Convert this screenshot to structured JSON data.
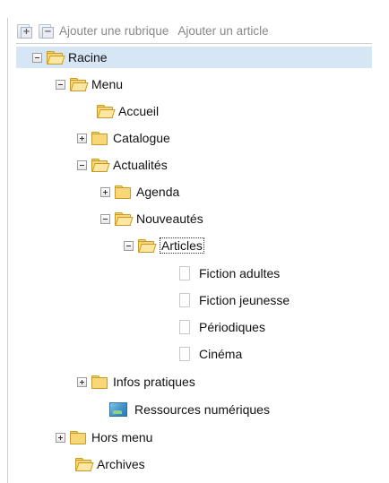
{
  "toolbar": {
    "add_section_label": "Ajouter une rubrique",
    "add_article_label": "Ajouter un article"
  },
  "tree": {
    "root": "Racine",
    "menu": "Menu",
    "accueil": "Accueil",
    "catalogue": "Catalogue",
    "actualites": "Actualités",
    "agenda": "Agenda",
    "nouveautes": "Nouveautés",
    "articles": "Articles",
    "fiction_adultes": "Fiction adultes",
    "fiction_jeunesse": "Fiction jeunesse",
    "periodiques": "Périodiques",
    "cinema": "Cinéma",
    "infos_pratiques": "Infos pratiques",
    "ressources_numeriques": "Ressources numériques",
    "hors_menu": "Hors menu",
    "archives": "Archives"
  },
  "colors": {
    "selected_row": "#d6e6f5",
    "folder": "#f7d777"
  }
}
